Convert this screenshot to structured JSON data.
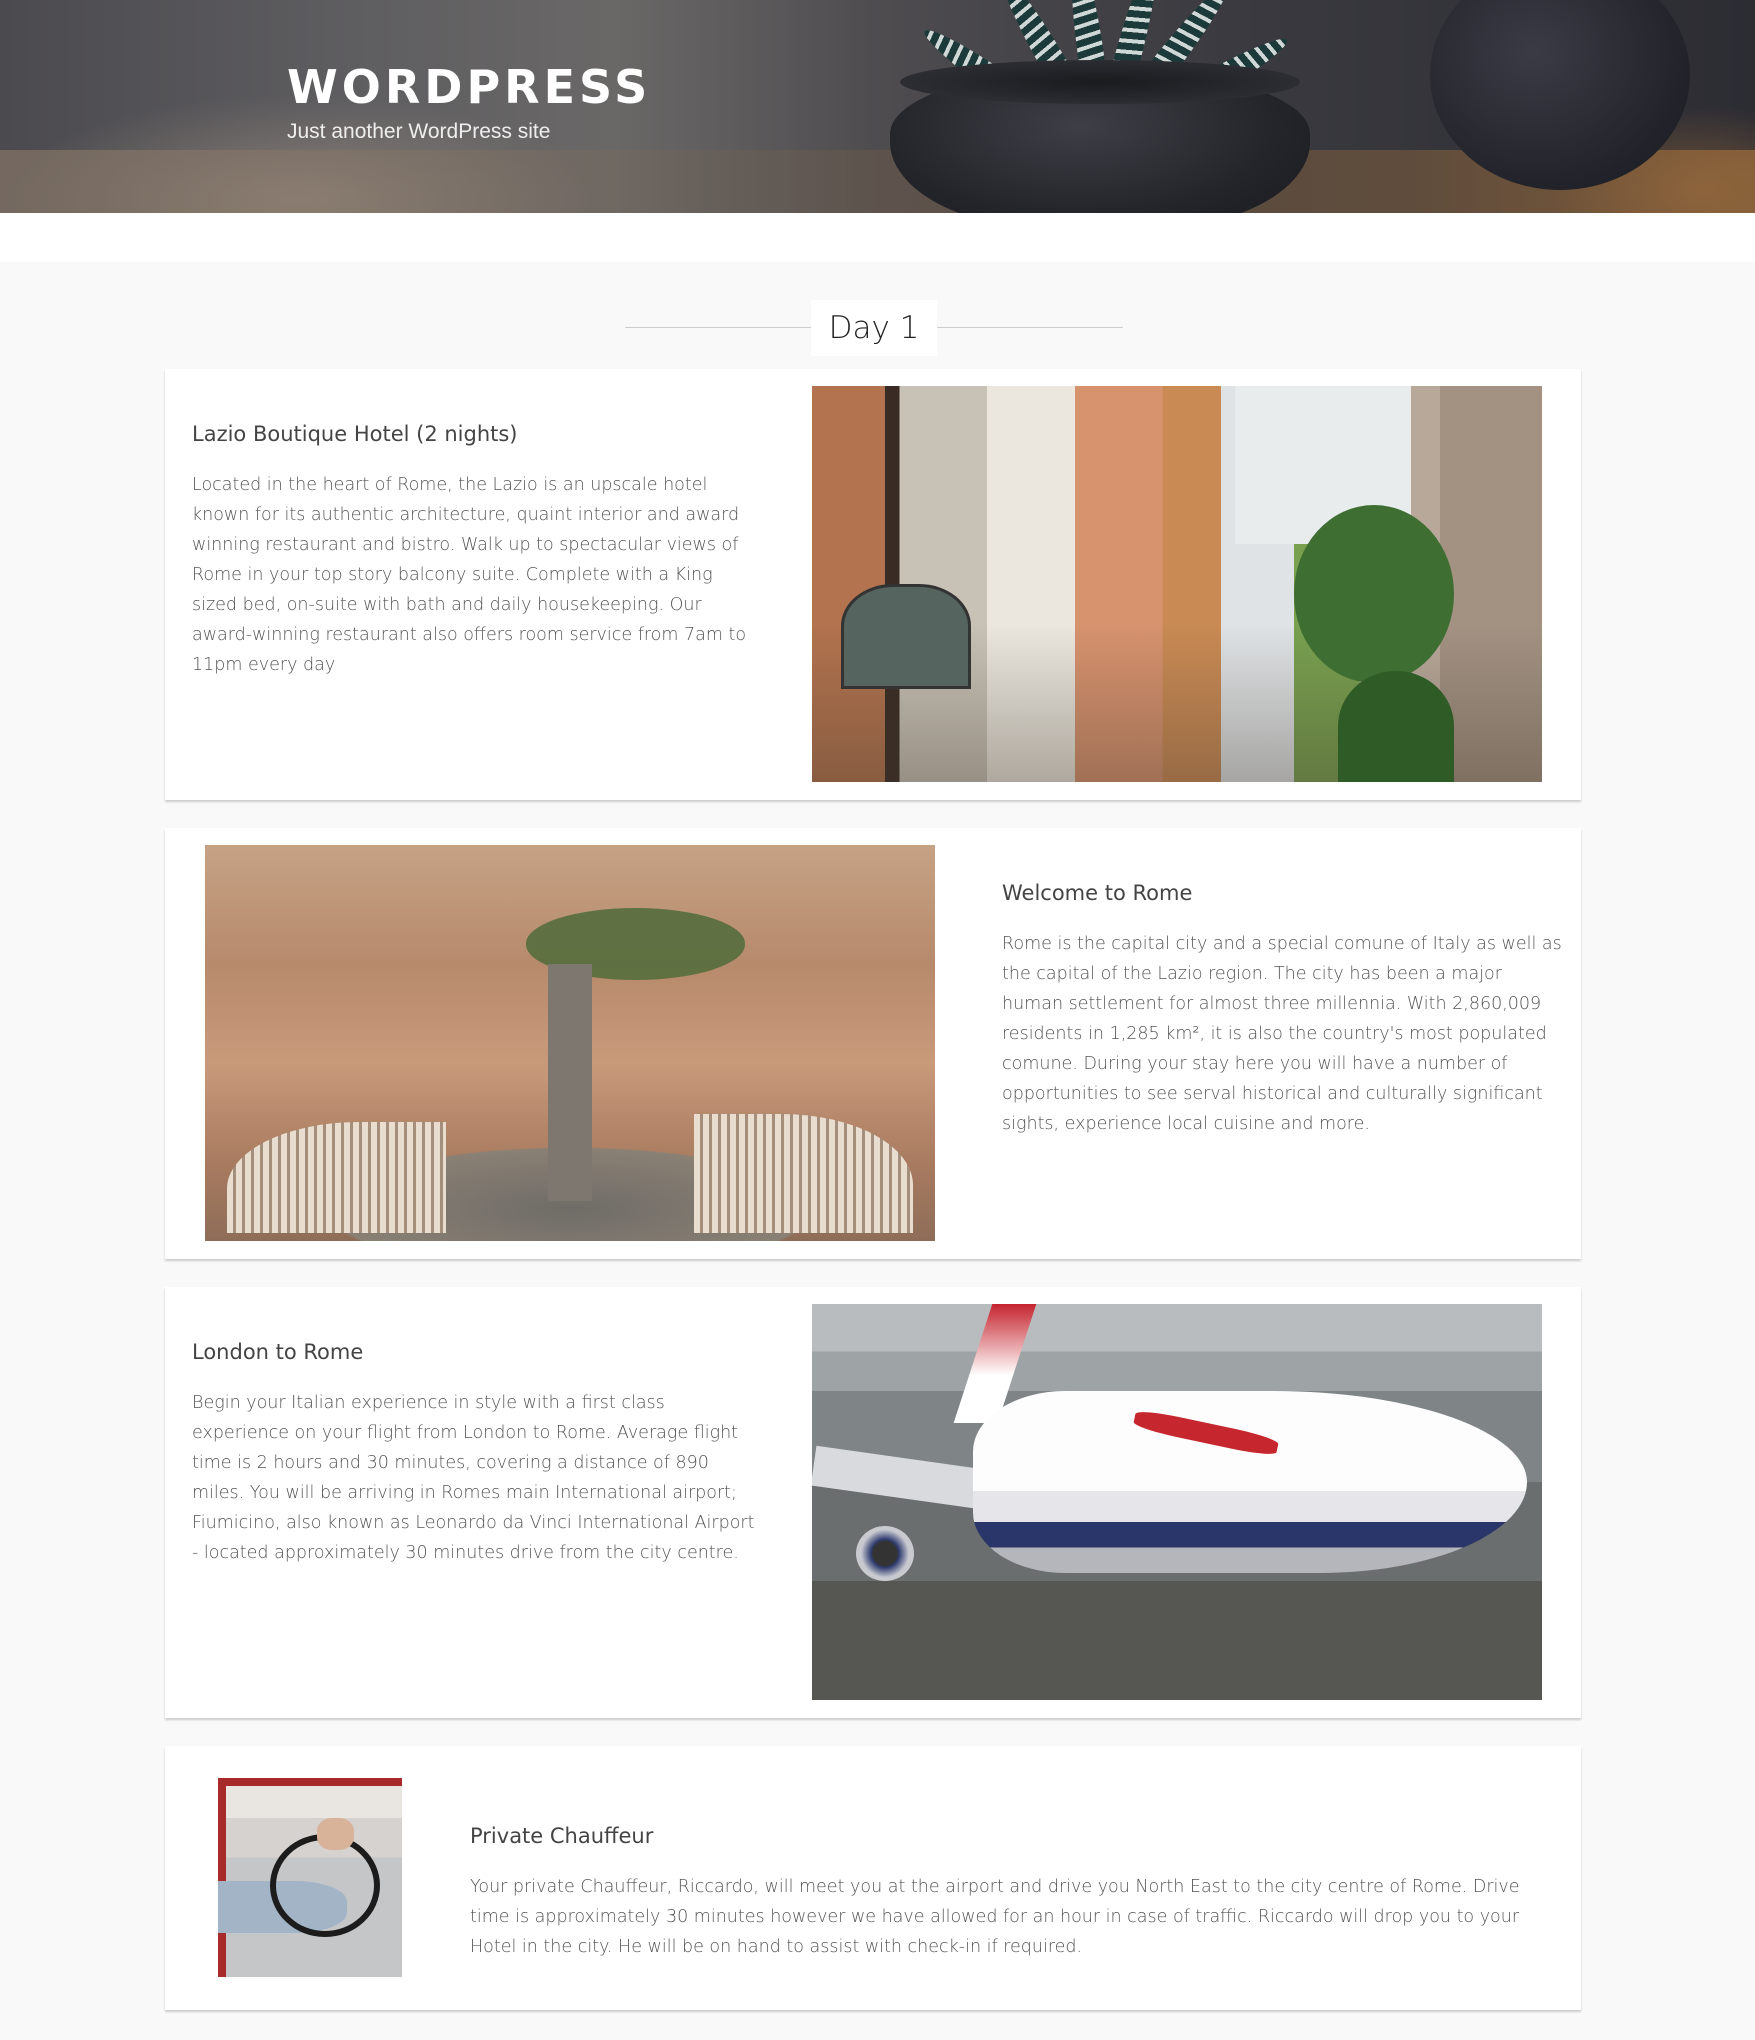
{
  "site": {
    "title": "WORDPRESS",
    "description": "Just another WordPress site"
  },
  "day": {
    "heading": "Day 1"
  },
  "items": [
    {
      "title": "Lazio Boutique Hotel (2 nights)",
      "text": "Located in the heart of Rome, the Lazio is an upscale hotel known for its authentic architecture, quaint interior and award winning restaurant and bistro. Walk up to spectacular views of Rome in your top story balcony suite. Complete with a King sized bed, on-suite with bath and daily housekeeping. Our award-winning restaurant also offers room service from 7am to 11pm every day"
    },
    {
      "title": "Welcome to Rome",
      "text": "Rome is the capital city and a special comune of Italy as well as the capital of the Lazio region. The city has been a major human settlement for almost three millennia. With 2,860,009 residents in 1,285 km², it is also the country's most populated comune. During your stay here you will have a number of opportunities to see serval historical and culturally significant sights, experience local cuisine and more."
    },
    {
      "title": "London to Rome",
      "text": "Begin your Italian experience in style with a first class experience on your flight from London to Rome. Average flight time is 2 hours and 30 minutes, covering a distance of 890 miles. You will be arriving in Romes main International airport; Fiumicino, also known as Leonardo da Vinci International Airport - located approximately 30 minutes drive from the city centre."
    },
    {
      "title": "Private Chauffeur",
      "text": "Your private Chauffeur, Riccardo, will meet you at the airport and drive you North East to the city centre of Rome. Drive time is approximately 30 minutes however we have allowed for an hour in case of traffic. Riccardo will drop you to your Hotel in the city. He will be on hand to assist with check-in if required."
    }
  ]
}
